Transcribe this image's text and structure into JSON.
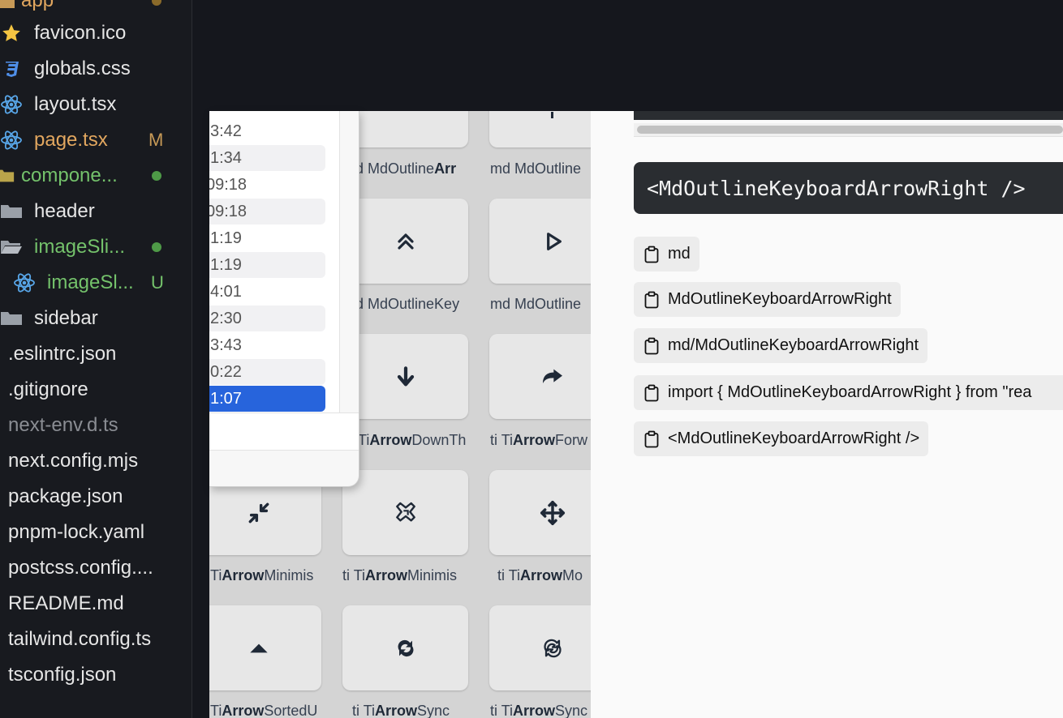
{
  "explorer": {
    "items": [
      {
        "label": "app",
        "color": "#e2a75f",
        "badge": "",
        "dot": "#8a6a2a",
        "icon": "folder-open-icon"
      },
      {
        "label": "favicon.ico",
        "color": "#e6e6e6",
        "badge": "",
        "dot": "",
        "icon": "star-icon"
      },
      {
        "label": "globals.css",
        "color": "#e6e6e6",
        "badge": "",
        "dot": "",
        "icon": "css-icon"
      },
      {
        "label": "layout.tsx",
        "color": "#e6e6e6",
        "badge": "",
        "dot": "",
        "icon": "react-icon"
      },
      {
        "label": "page.tsx",
        "color": "#e2a75f",
        "badge": "M",
        "dot": "",
        "icon": "react-icon"
      },
      {
        "label": "compone...",
        "color": "#74c26b",
        "badge": "",
        "dot": "#4e9a47",
        "icon": "folder-icon"
      },
      {
        "label": "header",
        "color": "#e6e6e6",
        "badge": "",
        "dot": "",
        "icon": "folder-icon"
      },
      {
        "label": "imageSli...",
        "color": "#74c26b",
        "badge": "",
        "dot": "#4e9a47",
        "icon": "folder-open-icon"
      },
      {
        "label": "imageSl...",
        "color": "#74c26b",
        "badge": "U",
        "dot": "",
        "icon": "react-icon"
      },
      {
        "label": "sidebar",
        "color": "#e6e6e6",
        "badge": "",
        "dot": "",
        "icon": "folder-icon"
      },
      {
        "label": ".eslintrc.json",
        "color": "#e6e6e6",
        "badge": "",
        "dot": "",
        "icon": ""
      },
      {
        "label": ".gitignore",
        "color": "#e6e6e6",
        "badge": "",
        "dot": "",
        "icon": ""
      },
      {
        "label": "next-env.d.ts",
        "color": "#8a8d93",
        "badge": "",
        "dot": "",
        "icon": ""
      },
      {
        "label": "next.config.mjs",
        "color": "#e6e6e6",
        "badge": "",
        "dot": "",
        "icon": ""
      },
      {
        "label": "package.json",
        "color": "#e6e6e6",
        "badge": "",
        "dot": "",
        "icon": ""
      },
      {
        "label": "pnpm-lock.yaml",
        "color": "#e6e6e6",
        "badge": "",
        "dot": "",
        "icon": ""
      },
      {
        "label": "postcss.config....",
        "color": "#e6e6e6",
        "badge": "",
        "dot": "",
        "icon": ""
      },
      {
        "label": "README.md",
        "color": "#e6e6e6",
        "badge": "",
        "dot": "",
        "icon": ""
      },
      {
        "label": "tailwind.config.ts",
        "color": "#e6e6e6",
        "badge": "",
        "dot": "",
        "icon": ""
      },
      {
        "label": "tsconfig.json",
        "color": "#e6e6e6",
        "badge": "",
        "dot": "",
        "icon": ""
      }
    ]
  },
  "popup": {
    "times": [
      "3:42",
      "1:34",
      "09:18",
      "09:18",
      "1:19",
      "1:19",
      "4:01",
      "2:30",
      "3:43",
      "0:22",
      "1:07"
    ],
    "selected_index": 10
  },
  "grid": {
    "tiles": [
      {
        "icon": "",
        "prefix": "d ",
        "bold": "",
        "name": "MdOutline",
        "boldname": "Arr"
      },
      {
        "icon": "",
        "prefix": "md ",
        "bold": "",
        "name": "MdOutline",
        "boldname": ""
      },
      {
        "icon": "chevrons-up-icon",
        "prefix": "d ",
        "bold": "",
        "name": "MdOutlineKey",
        "boldname": ""
      },
      {
        "icon": "play-outline-icon",
        "prefix": "md ",
        "bold": "",
        "name": "MdOutline",
        "boldname": ""
      },
      {
        "icon": "arrow-down-icon",
        "prefix": "",
        "bold": "Ti",
        "name": "Ti",
        "boldname": "Arrow",
        "suffix": "DownTh"
      },
      {
        "icon": "arrow-forward-icon",
        "prefix": "ti ",
        "bold": "",
        "name": "Ti",
        "boldname": "Arrow",
        "suffix": "Forw"
      },
      {
        "icon": "arrow-minimise-icon",
        "prefix": "",
        "bold": "",
        "name": "Ti",
        "boldname": "Arrow",
        "suffix": "Minimis"
      },
      {
        "icon": "arrow-minimise-outline-icon",
        "prefix": "ti ",
        "bold": "",
        "name": "Ti",
        "boldname": "Arrow",
        "suffix": "Minimis"
      },
      {
        "icon": "arrow-move-icon",
        "prefix": "ti ",
        "bold": "",
        "name": "Ti",
        "boldname": "Arrow",
        "suffix": "Mo"
      },
      {
        "icon": "triangle-up-icon",
        "prefix": "",
        "bold": "",
        "name": "Ti",
        "boldname": "Arrow",
        "suffix": "SortedU"
      },
      {
        "icon": "sync-icon",
        "prefix": "ti ",
        "bold": "",
        "name": "Ti",
        "boldname": "Arrow",
        "suffix": "Sync"
      },
      {
        "icon": "sync-outline-icon",
        "prefix": "ti ",
        "bold": "",
        "name": "Ti",
        "boldname": "Arrow",
        "suffix": "Sync"
      }
    ]
  },
  "detail": {
    "code": "<MdOutlineKeyboardArrowRight />",
    "chips": [
      "md",
      "MdOutlineKeyboardArrowRight",
      "md/MdOutlineKeyboardArrowRight",
      "import { MdOutlineKeyboardArrowRight } from \"rea",
      "<MdOutlineKeyboardArrowRight />"
    ]
  }
}
